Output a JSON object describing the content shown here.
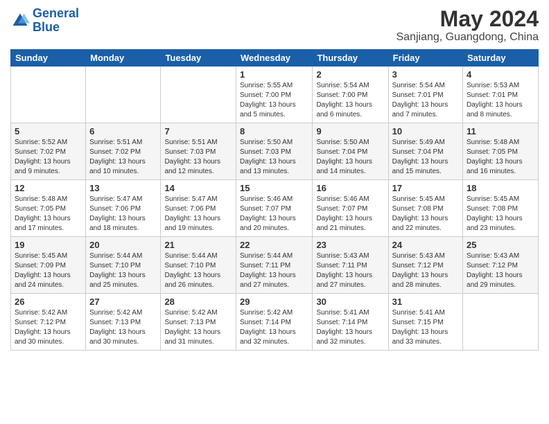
{
  "header": {
    "logo_line1": "General",
    "logo_line2": "Blue",
    "month_title": "May 2024",
    "location": "Sanjiang, Guangdong, China"
  },
  "weekdays": [
    "Sunday",
    "Monday",
    "Tuesday",
    "Wednesday",
    "Thursday",
    "Friday",
    "Saturday"
  ],
  "weeks": [
    [
      {
        "day": "",
        "sunrise": "",
        "sunset": "",
        "daylight": ""
      },
      {
        "day": "",
        "sunrise": "",
        "sunset": "",
        "daylight": ""
      },
      {
        "day": "",
        "sunrise": "",
        "sunset": "",
        "daylight": ""
      },
      {
        "day": "1",
        "sunrise": "Sunrise: 5:55 AM",
        "sunset": "Sunset: 7:00 PM",
        "daylight": "Daylight: 13 hours and 5 minutes."
      },
      {
        "day": "2",
        "sunrise": "Sunrise: 5:54 AM",
        "sunset": "Sunset: 7:00 PM",
        "daylight": "Daylight: 13 hours and 6 minutes."
      },
      {
        "day": "3",
        "sunrise": "Sunrise: 5:54 AM",
        "sunset": "Sunset: 7:01 PM",
        "daylight": "Daylight: 13 hours and 7 minutes."
      },
      {
        "day": "4",
        "sunrise": "Sunrise: 5:53 AM",
        "sunset": "Sunset: 7:01 PM",
        "daylight": "Daylight: 13 hours and 8 minutes."
      }
    ],
    [
      {
        "day": "5",
        "sunrise": "Sunrise: 5:52 AM",
        "sunset": "Sunset: 7:02 PM",
        "daylight": "Daylight: 13 hours and 9 minutes."
      },
      {
        "day": "6",
        "sunrise": "Sunrise: 5:51 AM",
        "sunset": "Sunset: 7:02 PM",
        "daylight": "Daylight: 13 hours and 10 minutes."
      },
      {
        "day": "7",
        "sunrise": "Sunrise: 5:51 AM",
        "sunset": "Sunset: 7:03 PM",
        "daylight": "Daylight: 13 hours and 12 minutes."
      },
      {
        "day": "8",
        "sunrise": "Sunrise: 5:50 AM",
        "sunset": "Sunset: 7:03 PM",
        "daylight": "Daylight: 13 hours and 13 minutes."
      },
      {
        "day": "9",
        "sunrise": "Sunrise: 5:50 AM",
        "sunset": "Sunset: 7:04 PM",
        "daylight": "Daylight: 13 hours and 14 minutes."
      },
      {
        "day": "10",
        "sunrise": "Sunrise: 5:49 AM",
        "sunset": "Sunset: 7:04 PM",
        "daylight": "Daylight: 13 hours and 15 minutes."
      },
      {
        "day": "11",
        "sunrise": "Sunrise: 5:48 AM",
        "sunset": "Sunset: 7:05 PM",
        "daylight": "Daylight: 13 hours and 16 minutes."
      }
    ],
    [
      {
        "day": "12",
        "sunrise": "Sunrise: 5:48 AM",
        "sunset": "Sunset: 7:05 PM",
        "daylight": "Daylight: 13 hours and 17 minutes."
      },
      {
        "day": "13",
        "sunrise": "Sunrise: 5:47 AM",
        "sunset": "Sunset: 7:06 PM",
        "daylight": "Daylight: 13 hours and 18 minutes."
      },
      {
        "day": "14",
        "sunrise": "Sunrise: 5:47 AM",
        "sunset": "Sunset: 7:06 PM",
        "daylight": "Daylight: 13 hours and 19 minutes."
      },
      {
        "day": "15",
        "sunrise": "Sunrise: 5:46 AM",
        "sunset": "Sunset: 7:07 PM",
        "daylight": "Daylight: 13 hours and 20 minutes."
      },
      {
        "day": "16",
        "sunrise": "Sunrise: 5:46 AM",
        "sunset": "Sunset: 7:07 PM",
        "daylight": "Daylight: 13 hours and 21 minutes."
      },
      {
        "day": "17",
        "sunrise": "Sunrise: 5:45 AM",
        "sunset": "Sunset: 7:08 PM",
        "daylight": "Daylight: 13 hours and 22 minutes."
      },
      {
        "day": "18",
        "sunrise": "Sunrise: 5:45 AM",
        "sunset": "Sunset: 7:08 PM",
        "daylight": "Daylight: 13 hours and 23 minutes."
      }
    ],
    [
      {
        "day": "19",
        "sunrise": "Sunrise: 5:45 AM",
        "sunset": "Sunset: 7:09 PM",
        "daylight": "Daylight: 13 hours and 24 minutes."
      },
      {
        "day": "20",
        "sunrise": "Sunrise: 5:44 AM",
        "sunset": "Sunset: 7:10 PM",
        "daylight": "Daylight: 13 hours and 25 minutes."
      },
      {
        "day": "21",
        "sunrise": "Sunrise: 5:44 AM",
        "sunset": "Sunset: 7:10 PM",
        "daylight": "Daylight: 13 hours and 26 minutes."
      },
      {
        "day": "22",
        "sunrise": "Sunrise: 5:44 AM",
        "sunset": "Sunset: 7:11 PM",
        "daylight": "Daylight: 13 hours and 27 minutes."
      },
      {
        "day": "23",
        "sunrise": "Sunrise: 5:43 AM",
        "sunset": "Sunset: 7:11 PM",
        "daylight": "Daylight: 13 hours and 27 minutes."
      },
      {
        "day": "24",
        "sunrise": "Sunrise: 5:43 AM",
        "sunset": "Sunset: 7:12 PM",
        "daylight": "Daylight: 13 hours and 28 minutes."
      },
      {
        "day": "25",
        "sunrise": "Sunrise: 5:43 AM",
        "sunset": "Sunset: 7:12 PM",
        "daylight": "Daylight: 13 hours and 29 minutes."
      }
    ],
    [
      {
        "day": "26",
        "sunrise": "Sunrise: 5:42 AM",
        "sunset": "Sunset: 7:12 PM",
        "daylight": "Daylight: 13 hours and 30 minutes."
      },
      {
        "day": "27",
        "sunrise": "Sunrise: 5:42 AM",
        "sunset": "Sunset: 7:13 PM",
        "daylight": "Daylight: 13 hours and 30 minutes."
      },
      {
        "day": "28",
        "sunrise": "Sunrise: 5:42 AM",
        "sunset": "Sunset: 7:13 PM",
        "daylight": "Daylight: 13 hours and 31 minutes."
      },
      {
        "day": "29",
        "sunrise": "Sunrise: 5:42 AM",
        "sunset": "Sunset: 7:14 PM",
        "daylight": "Daylight: 13 hours and 32 minutes."
      },
      {
        "day": "30",
        "sunrise": "Sunrise: 5:41 AM",
        "sunset": "Sunset: 7:14 PM",
        "daylight": "Daylight: 13 hours and 32 minutes."
      },
      {
        "day": "31",
        "sunrise": "Sunrise: 5:41 AM",
        "sunset": "Sunset: 7:15 PM",
        "daylight": "Daylight: 13 hours and 33 minutes."
      },
      {
        "day": "",
        "sunrise": "",
        "sunset": "",
        "daylight": ""
      }
    ]
  ]
}
